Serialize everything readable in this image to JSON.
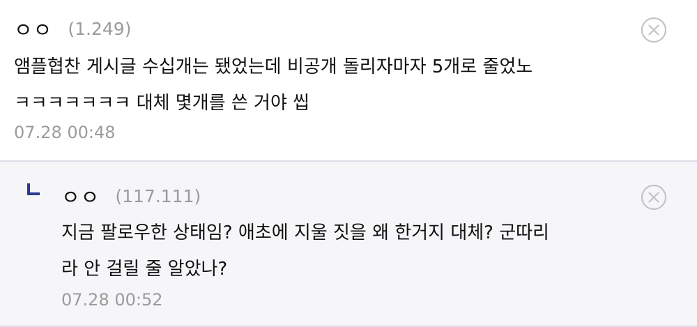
{
  "comments": [
    {
      "nickname": "ㅇㅇ",
      "ip": "(1.249)",
      "text": "앰플협찬 게시글 수십개는 됐었는데 비공개 돌리자마자 5개로 줄었노\nㅋㅋㅋㅋㅋㅋㅋ 대체 몇개를 쓴 거야 씹",
      "timestamp": "07.28 00:48",
      "delete_icon": "close-circle-icon"
    }
  ],
  "replies": [
    {
      "nickname": "ㅇㅇ",
      "ip": "(117.111)",
      "text": "지금 팔로우한 상태임? 애초에 지울 짓을 왜 한거지 대체? 군따리\n라 안 걸릴 줄 알았나?",
      "timestamp": "07.28 00:52",
      "reply_icon": "reply-arrow-icon",
      "delete_icon": "close-circle-icon"
    }
  ],
  "colors": {
    "text": "#111111",
    "meta": "#9b9b9b",
    "reply_bg": "#f6f6f9",
    "divider": "#dcdce6",
    "reply_icon": "#2b3a8c",
    "delete_icon": "#c4c4c4"
  }
}
